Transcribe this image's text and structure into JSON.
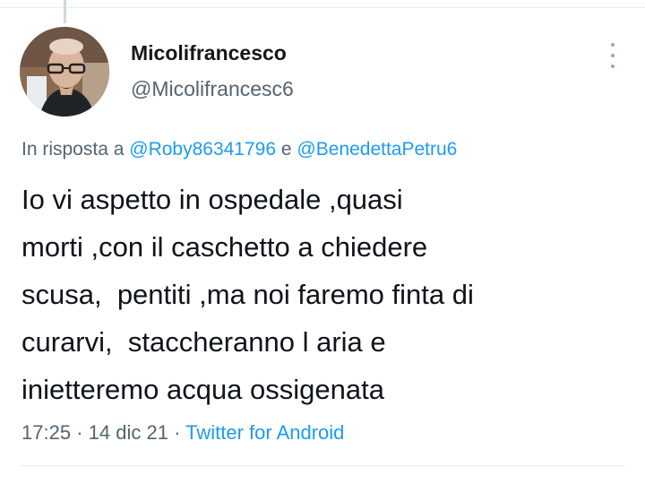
{
  "user": {
    "display_name": "Micolifrancesco",
    "handle": "@Micolifrancesc6",
    "avatar": "profile-photo"
  },
  "reply": {
    "prefix": "In risposta a",
    "mention_1": "@Roby86341796",
    "conjunction": "e",
    "mention_2": "@BenedettaPetru6"
  },
  "tweet": {
    "lines": [
      "Io vi aspetto in ospedale ,quasi",
      "morti ,con il caschetto a chiedere",
      "scusa,  pentiti ,ma noi faremo finta di",
      "curarvi,  staccheranno l aria e",
      "inietteremo acqua ossigenata"
    ]
  },
  "meta": {
    "time": "17:25",
    "separator": "·",
    "date": "14 dic 21",
    "source": "Twitter for Android"
  },
  "icons": {
    "more": "more-vertical-icon"
  },
  "colors": {
    "link": "#1d9bf0",
    "secondary_text": "#536471",
    "primary_text": "#0f1419"
  }
}
